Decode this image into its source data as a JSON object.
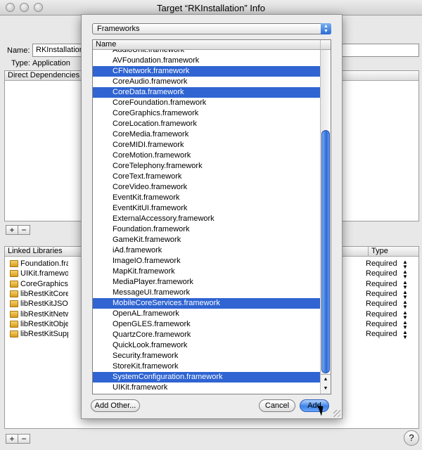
{
  "window": {
    "title": "Target “RKInstallation” Info"
  },
  "info": {
    "name_label": "Name:",
    "name_value": "RKInstallation",
    "type_label": "Type:",
    "type_value": "Application"
  },
  "dependencies": {
    "header": "Direct Dependencies",
    "add": "+",
    "remove": "−"
  },
  "linked": {
    "header": "Linked Libraries",
    "type_header": "Type",
    "add": "+",
    "remove": "−",
    "rows": [
      {
        "name": "Foundation.framework",
        "type": "Required"
      },
      {
        "name": "UIKit.framework",
        "type": "Required"
      },
      {
        "name": "CoreGraphics.framework",
        "type": "Required"
      },
      {
        "name": "libRestKitCoreData.a",
        "type": "Required"
      },
      {
        "name": "libRestKitJSONParser.a",
        "type": "Required"
      },
      {
        "name": "libRestKitNetwork.a",
        "type": "Required"
      },
      {
        "name": "libRestKitObjectMapping.a",
        "type": "Required"
      },
      {
        "name": "libRestKitSupport.a",
        "type": "Required"
      }
    ]
  },
  "help": "?",
  "sheet": {
    "popup_value": "Frameworks",
    "column_header": "Name",
    "items": [
      {
        "label": "AudioUnit.framework",
        "selected": false
      },
      {
        "label": "AVFoundation.framework",
        "selected": false
      },
      {
        "label": "CFNetwork.framework",
        "selected": true
      },
      {
        "label": "CoreAudio.framework",
        "selected": false
      },
      {
        "label": "CoreData.framework",
        "selected": true
      },
      {
        "label": "CoreFoundation.framework",
        "selected": false
      },
      {
        "label": "CoreGraphics.framework",
        "selected": false
      },
      {
        "label": "CoreLocation.framework",
        "selected": false
      },
      {
        "label": "CoreMedia.framework",
        "selected": false
      },
      {
        "label": "CoreMIDI.framework",
        "selected": false
      },
      {
        "label": "CoreMotion.framework",
        "selected": false
      },
      {
        "label": "CoreTelephony.framework",
        "selected": false
      },
      {
        "label": "CoreText.framework",
        "selected": false
      },
      {
        "label": "CoreVideo.framework",
        "selected": false
      },
      {
        "label": "EventKit.framework",
        "selected": false
      },
      {
        "label": "EventKitUI.framework",
        "selected": false
      },
      {
        "label": "ExternalAccessory.framework",
        "selected": false
      },
      {
        "label": "Foundation.framework",
        "selected": false
      },
      {
        "label": "GameKit.framework",
        "selected": false
      },
      {
        "label": "iAd.framework",
        "selected": false
      },
      {
        "label": "ImageIO.framework",
        "selected": false
      },
      {
        "label": "MapKit.framework",
        "selected": false
      },
      {
        "label": "MediaPlayer.framework",
        "selected": false
      },
      {
        "label": "MessageUI.framework",
        "selected": false
      },
      {
        "label": "MobileCoreServices.framework",
        "selected": true
      },
      {
        "label": "OpenAL.framework",
        "selected": false
      },
      {
        "label": "OpenGLES.framework",
        "selected": false
      },
      {
        "label": "QuartzCore.framework",
        "selected": false
      },
      {
        "label": "QuickLook.framework",
        "selected": false
      },
      {
        "label": "Security.framework",
        "selected": false
      },
      {
        "label": "StoreKit.framework",
        "selected": false
      },
      {
        "label": "SystemConfiguration.framework",
        "selected": true
      },
      {
        "label": "UIKit.framework",
        "selected": false
      }
    ],
    "add_other_label": "Add Other...",
    "cancel_label": "Cancel",
    "add_label": "Add"
  },
  "colors": {
    "selection": "#2f64d2",
    "accent": "#3d83e6"
  }
}
